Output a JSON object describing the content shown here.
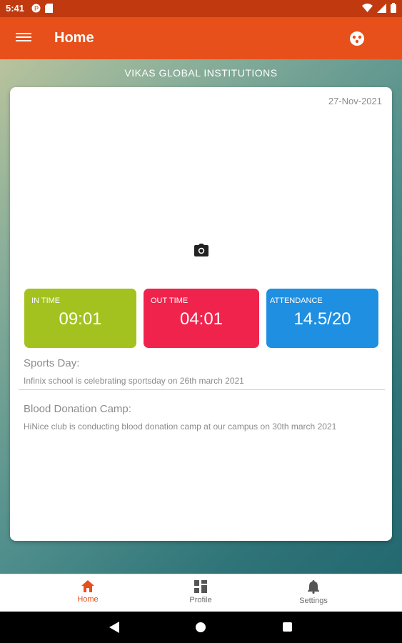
{
  "status_bar": {
    "time": "5:41"
  },
  "app_bar": {
    "title": "Home"
  },
  "org_name": "VIKAS GLOBAL INSTITUTIONS",
  "card": {
    "date": "27-Nov-2021",
    "stats": [
      {
        "label": "IN TIME",
        "value": "09:01",
        "color": "#a3c21f"
      },
      {
        "label": "OUT TIME",
        "value": "04:01",
        "color": "#f0234d"
      },
      {
        "label": "ATTENDANCE",
        "value": "14.5/20",
        "color": "#1f8fe1"
      }
    ],
    "news": [
      {
        "title": "Sports Day:",
        "body": "Infinix school is celebrating sportsday on 26th march 2021"
      },
      {
        "title": "Blood Donation Camp:",
        "body": "HiNice club is conducting blood donation camp at our campus on 30th march 2021"
      }
    ]
  },
  "bottom_nav": [
    {
      "label": "Home",
      "icon": "home-icon",
      "active": true
    },
    {
      "label": "Profile",
      "icon": "profile-grid-icon",
      "active": false
    },
    {
      "label": "Settings",
      "icon": "bell-icon",
      "active": false
    }
  ],
  "colors": {
    "accent": "#e7501b",
    "status_bar": "#c13a0f"
  }
}
